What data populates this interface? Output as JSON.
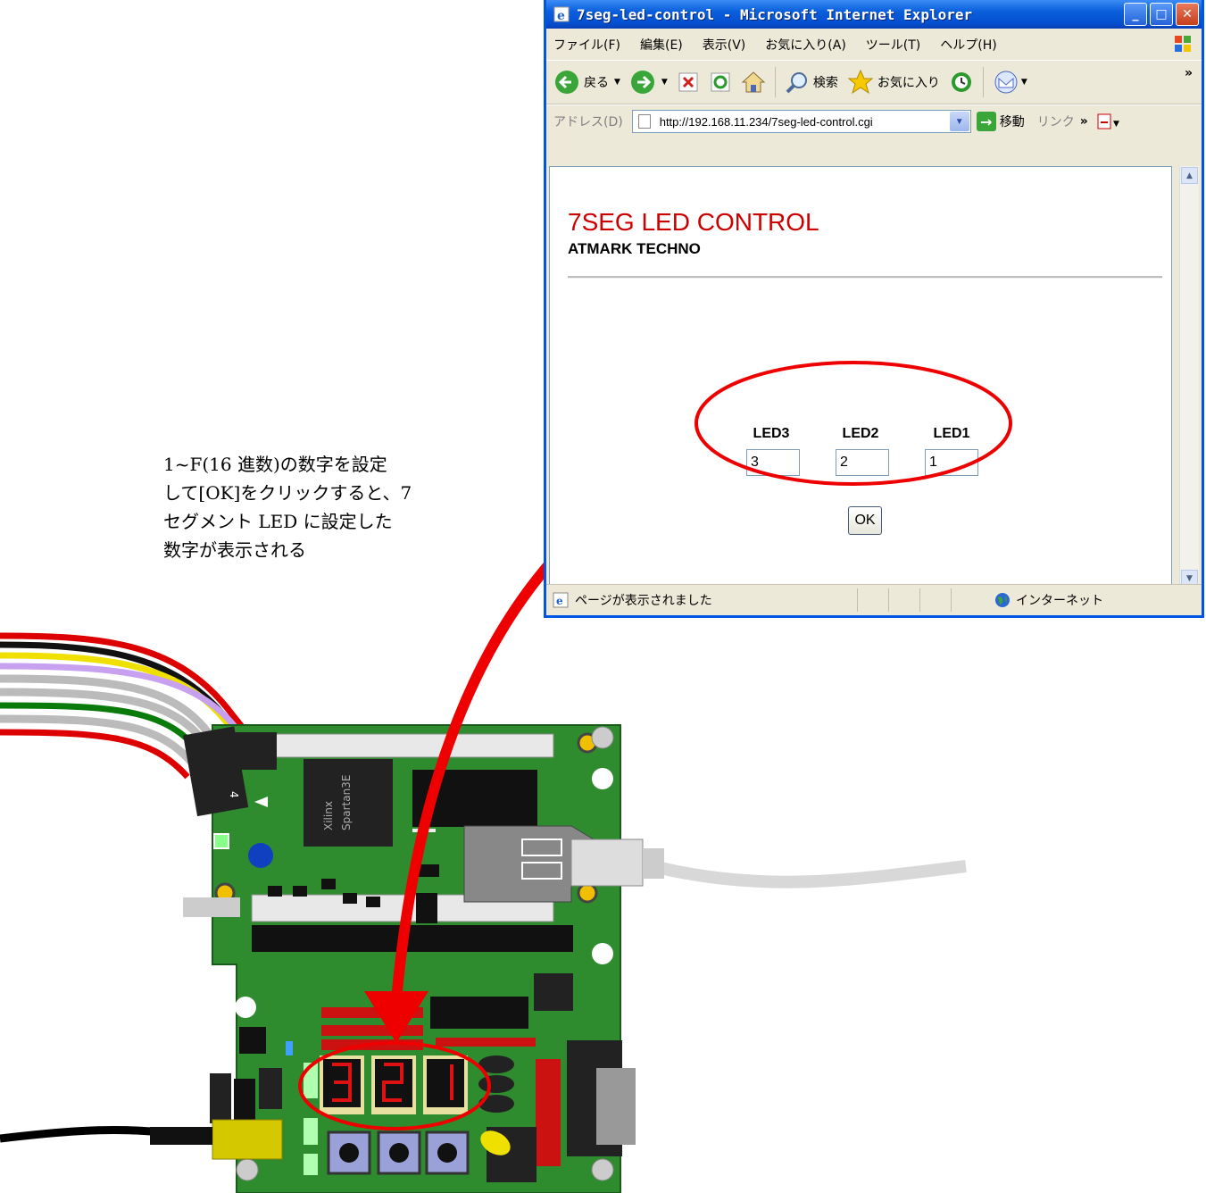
{
  "window": {
    "title": "7seg-led-control - Microsoft Internet Explorer",
    "min_label": "_",
    "max_label": "□",
    "close_label": "✕"
  },
  "menubar": {
    "items": [
      "ファイル(F)",
      "編集(E)",
      "表示(V)",
      "お気に入り(A)",
      "ツール(T)",
      "ヘルプ(H)"
    ]
  },
  "toolbar": {
    "back_label": "戻る",
    "search_label": "検索",
    "favorites_label": "お気に入り",
    "more_label": "»"
  },
  "addressbar": {
    "label": "アドレス(D)",
    "url": "http://192.168.11.234/7seg-led-control.cgi",
    "go_label": "移動",
    "links_label": "リンク",
    "links_more": "»"
  },
  "page": {
    "title": "7SEG LED CONTROL",
    "subtitle": "ATMARK TECHNO",
    "leds": [
      {
        "label": "LED3",
        "value": "3"
      },
      {
        "label": "LED2",
        "value": "2"
      },
      {
        "label": "LED1",
        "value": "1"
      }
    ],
    "ok_label": "OK"
  },
  "statusbar": {
    "text": "ページが表示されました",
    "zone": "インターネット"
  },
  "annotation": {
    "lines": [
      "1~F(16 進数)の数字を設定",
      "して[OK]をクリックすると、7",
      "セグメント LED に設定した",
      "数字が表示される"
    ]
  },
  "board": {
    "chip_label_1": "Xilinx",
    "chip_label_2": "Spartan3E",
    "header_mark": "4",
    "digits": [
      "3",
      "2",
      "1"
    ]
  },
  "colors": {
    "title_red": "#cc0000",
    "board_green": "#2e8b2e",
    "arrow_red": "#ee0000"
  }
}
